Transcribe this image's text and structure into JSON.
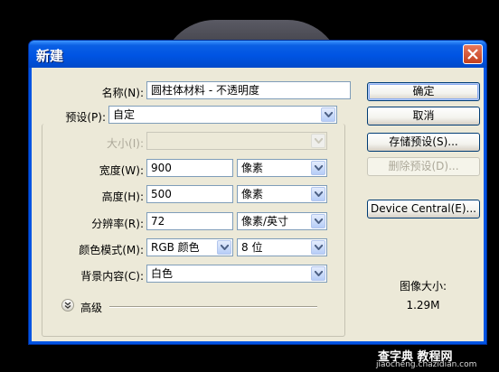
{
  "dialog": {
    "title": "新建",
    "name_label": "名称(N):",
    "name_value": "圆柱体材料 - 不透明度",
    "preset_label": "预设(P):",
    "preset_value": "自定",
    "size_label": "大小(I):",
    "size_value": "",
    "width_label": "宽度(W):",
    "width_value": "900",
    "width_unit": "像素",
    "height_label": "高度(H):",
    "height_value": "500",
    "height_unit": "像素",
    "resolution_label": "分辨率(R):",
    "resolution_value": "72",
    "resolution_unit": "像素/英寸",
    "color_mode_label": "颜色模式(M):",
    "color_mode_value": "RGB 颜色",
    "bit_depth_value": "8 位",
    "bg_label": "背景内容(C):",
    "bg_value": "白色",
    "advanced_label": "高级",
    "image_size_label": "图像大小:",
    "image_size_value": "1.29M"
  },
  "buttons": {
    "ok": "确定",
    "cancel": "取消",
    "save_preset": "存储预设(S)...",
    "delete_preset": "删除预设(D)...",
    "device_central": "Device Central(E)..."
  },
  "watermark": {
    "main": "查字典 教程网",
    "sub": "jiaocheng.chazidian.com"
  }
}
